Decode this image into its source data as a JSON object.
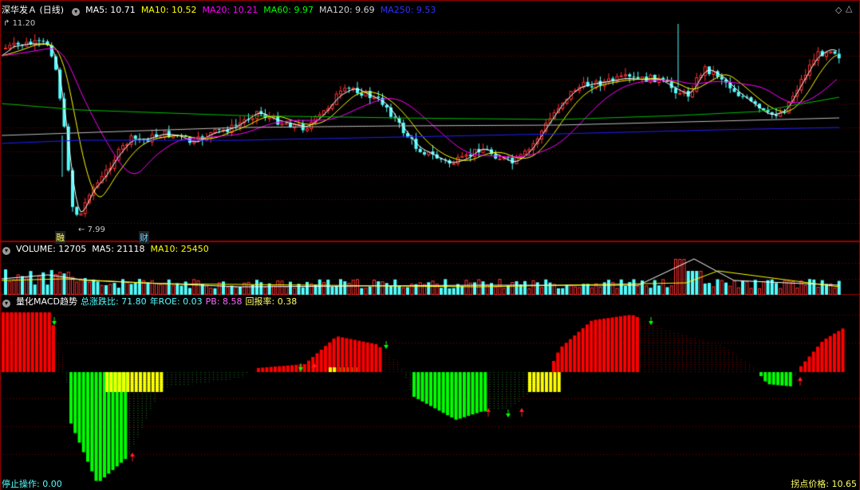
{
  "price_header": {
    "title": "深华发Ａ (日线)",
    "ma": [
      {
        "label": "MA5: 10.71",
        "color": "#ffffff"
      },
      {
        "label": "MA10: 10.52",
        "color": "#ffff00"
      },
      {
        "label": "MA20: 10.21",
        "color": "#ff00ff"
      },
      {
        "label": "MA60: 9.97",
        "color": "#00ff00"
      },
      {
        "label": "MA120: 9.69",
        "color": "#c8c8c8"
      },
      {
        "label": "MA250: 9.53",
        "color": "#0000ff"
      }
    ]
  },
  "price_high_label": "11.20",
  "price_low_label": "7.99",
  "event_markers": [
    "融",
    "财"
  ],
  "volume_header": {
    "title": "VOLUME: 12705",
    "ma5": "MA5: 21118",
    "ma10": "MA10: 25450"
  },
  "macd_header": {
    "title": "量化MACD趋势",
    "ratio": "总涨跌比: 71.80",
    "roe": "年ROE: 0.03",
    "pb": "PB: 8.58",
    "return_rate": "回报率: 0.38"
  },
  "stop_label": "停止操作: 0.00",
  "pivot_label": "拐点价格: 10.65",
  "colors": {
    "up": "#ff3232",
    "down": "#54ffff",
    "macd_pos": "#ff0000",
    "macd_neg": "#00ff00",
    "macd_weak": "#ffff00",
    "grid": "#800000",
    "border": "#a00000"
  }
}
